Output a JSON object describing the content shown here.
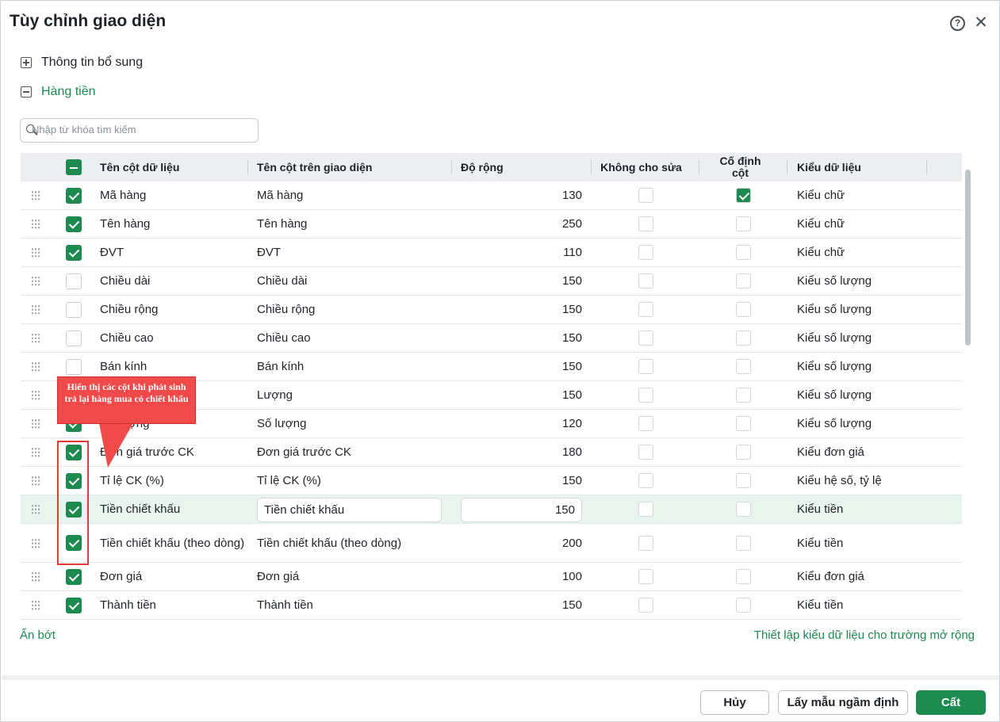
{
  "dialog": {
    "title": "Tùy chỉnh giao diện",
    "help_icon": "question-circle-icon",
    "close_icon": "close-icon"
  },
  "sections": {
    "more_info": "Thông tin bổ sung",
    "items": "Hàng tiền"
  },
  "search": {
    "placeholder": "Nhập từ khóa tìm kiếm"
  },
  "table": {
    "headers": {
      "name": "Tên cột dữ liệu",
      "display": "Tên cột trên giao diện",
      "width": "Độ rộng",
      "no_edit": "Không cho sửa",
      "fixed": "Cố định cột",
      "type": "Kiểu dữ liệu"
    },
    "header_checkbox": "indeterminate",
    "rows": [
      {
        "checked": true,
        "name": "Mã hàng",
        "display": "Mã hàng",
        "width": "130",
        "no_edit": false,
        "fixed": true,
        "type": "Kiểu chữ"
      },
      {
        "checked": true,
        "name": "Tên hàng",
        "display": "Tên hàng",
        "width": "250",
        "no_edit": false,
        "fixed": false,
        "type": "Kiểu chữ"
      },
      {
        "checked": true,
        "name": "ĐVT",
        "display": "ĐVT",
        "width": "110",
        "no_edit": false,
        "fixed": false,
        "type": "Kiểu chữ"
      },
      {
        "checked": false,
        "name": "Chiều dài",
        "display": "Chiều dài",
        "width": "150",
        "no_edit": false,
        "fixed": false,
        "type": "Kiểu số lượng"
      },
      {
        "checked": false,
        "name": "Chiều rộng",
        "display": "Chiều rộng",
        "width": "150",
        "no_edit": false,
        "fixed": false,
        "type": "Kiểu số lượng"
      },
      {
        "checked": false,
        "name": "Chiều cao",
        "display": "Chiều cao",
        "width": "150",
        "no_edit": false,
        "fixed": false,
        "type": "Kiểu số lượng"
      },
      {
        "checked": false,
        "name": "Bán kính",
        "display": "Bán kính",
        "width": "150",
        "no_edit": false,
        "fixed": false,
        "type": "Kiểu số lượng"
      },
      {
        "checked": false,
        "name": "Lượng",
        "display": "Lượng",
        "width": "150",
        "no_edit": false,
        "fixed": false,
        "type": "Kiểu số lượng"
      },
      {
        "checked": true,
        "name": "Số lượng",
        "display": "Số lượng",
        "width": "120",
        "no_edit": false,
        "fixed": false,
        "type": "Kiểu số lượng"
      },
      {
        "checked": true,
        "name": "Đơn giá trước CK",
        "display": "Đơn giá trước CK",
        "width": "180",
        "no_edit": false,
        "fixed": false,
        "type": "Kiểu đơn giá"
      },
      {
        "checked": true,
        "name": "Tỉ lệ CK (%)",
        "display": "Tỉ lệ CK (%)",
        "width": "150",
        "no_edit": false,
        "fixed": false,
        "type": "Kiểu hệ số, tỷ lệ"
      },
      {
        "checked": true,
        "name": "Tiền chiết khấu",
        "display": "Tiền chiết khấu",
        "width": "150",
        "no_edit": false,
        "fixed": false,
        "type": "Kiểu tiền",
        "active": true
      },
      {
        "checked": true,
        "name": "Tiền chiết khấu (theo dòng)",
        "display": "Tiền chiết khấu (theo dòng)",
        "width": "200",
        "no_edit": false,
        "fixed": false,
        "type": "Kiểu tiền",
        "tall": true
      },
      {
        "checked": true,
        "name": "Đơn giá",
        "display": "Đơn giá",
        "width": "100",
        "no_edit": false,
        "fixed": false,
        "type": "Kiểu đơn giá"
      },
      {
        "checked": true,
        "name": "Thành tiền",
        "display": "Thành tiền",
        "width": "150",
        "no_edit": false,
        "fixed": false,
        "type": "Kiểu tiền"
      }
    ]
  },
  "links": {
    "collapse": "Ẩn bớt",
    "extended_type": "Thiết lập kiểu dữ liệu cho trường mở rộng"
  },
  "footer": {
    "cancel": "Hủy",
    "default": "Lấy mẫu ngầm định",
    "save": "Cất"
  },
  "annotation": {
    "callout": "Hiển thị các cột khi phát sinh trả lại hàng mua có chiết khấu"
  },
  "colors": {
    "accent": "#1d8a4f",
    "callout": "#f04a4a",
    "active_row": "#e8f4ee"
  }
}
